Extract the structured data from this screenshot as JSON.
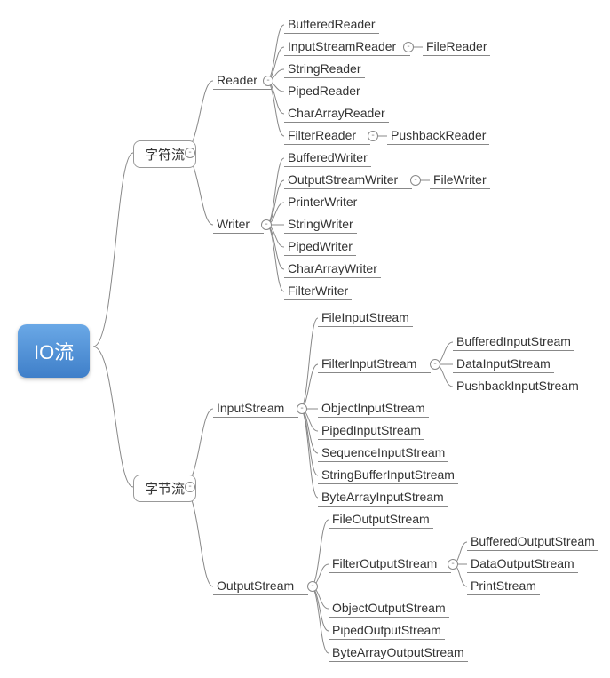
{
  "root": "IO流",
  "l1": {
    "char": "字符流",
    "byte": "字节流"
  },
  "l2": {
    "reader": "Reader",
    "writer": "Writer",
    "in": "InputStream",
    "out": "OutputStream"
  },
  "reader": {
    "buf": "BufferedReader",
    "isr": "InputStreamReader",
    "str": "StringReader",
    "pipe": "PipedReader",
    "ca": "CharArrayReader",
    "filt": "FilterReader",
    "isr_sub": "FileReader",
    "filt_sub": "PushbackReader"
  },
  "writer": {
    "buf": "BufferedWriter",
    "osw": "OutputStreamWriter",
    "pr": "PrinterWriter",
    "str": "StringWriter",
    "pipe": "PipedWriter",
    "ca": "CharArrayWriter",
    "filt": "FilterWriter",
    "osw_sub": "FileWriter"
  },
  "in": {
    "file": "FileInputStream",
    "filt": "FilterInputStream",
    "obj": "ObjectInputStream",
    "pipe": "PipedInputStream",
    "seq": "SequenceInputStream",
    "sb": "StringBufferInputStream",
    "ba": "ByteArrayInputStream",
    "filt_a": "BufferedInputStream",
    "filt_b": "DataInputStream",
    "filt_c": "PushbackInputStream"
  },
  "out": {
    "file": "FileOutputStream",
    "filt": "FilterOutputStream",
    "obj": "ObjectOutputStream",
    "pipe": "PipedOutputStream",
    "ba": "ByteArrayOutputStream",
    "filt_a": "BufferedOutputStream",
    "filt_b": "DataOutputStream",
    "filt_c": "PrintStream"
  },
  "chart_data": {
    "type": "tree",
    "root": {
      "name": "IO流",
      "children": [
        {
          "name": "字符流",
          "children": [
            {
              "name": "Reader",
              "children": [
                {
                  "name": "BufferedReader"
                },
                {
                  "name": "InputStreamReader",
                  "children": [
                    {
                      "name": "FileReader"
                    }
                  ]
                },
                {
                  "name": "StringReader"
                },
                {
                  "name": "PipedReader"
                },
                {
                  "name": "CharArrayReader"
                },
                {
                  "name": "FilterReader",
                  "children": [
                    {
                      "name": "PushbackReader"
                    }
                  ]
                }
              ]
            },
            {
              "name": "Writer",
              "children": [
                {
                  "name": "BufferedWriter"
                },
                {
                  "name": "OutputStreamWriter",
                  "children": [
                    {
                      "name": "FileWriter"
                    }
                  ]
                },
                {
                  "name": "PrinterWriter"
                },
                {
                  "name": "StringWriter"
                },
                {
                  "name": "PipedWriter"
                },
                {
                  "name": "CharArrayWriter"
                },
                {
                  "name": "FilterWriter"
                }
              ]
            }
          ]
        },
        {
          "name": "字节流",
          "children": [
            {
              "name": "InputStream",
              "children": [
                {
                  "name": "FileInputStream"
                },
                {
                  "name": "FilterInputStream",
                  "children": [
                    {
                      "name": "BufferedInputStream"
                    },
                    {
                      "name": "DataInputStream"
                    },
                    {
                      "name": "PushbackInputStream"
                    }
                  ]
                },
                {
                  "name": "ObjectInputStream"
                },
                {
                  "name": "PipedInputStream"
                },
                {
                  "name": "SequenceInputStream"
                },
                {
                  "name": "StringBufferInputStream"
                },
                {
                  "name": "ByteArrayInputStream"
                }
              ]
            },
            {
              "name": "OutputStream",
              "children": [
                {
                  "name": "FileOutputStream"
                },
                {
                  "name": "FilterOutputStream",
                  "children": [
                    {
                      "name": "BufferedOutputStream"
                    },
                    {
                      "name": "DataOutputStream"
                    },
                    {
                      "name": "PrintStream"
                    }
                  ]
                },
                {
                  "name": "ObjectOutputStream"
                },
                {
                  "name": "PipedOutputStream"
                },
                {
                  "name": "ByteArrayOutputStream"
                }
              ]
            }
          ]
        }
      ]
    }
  }
}
